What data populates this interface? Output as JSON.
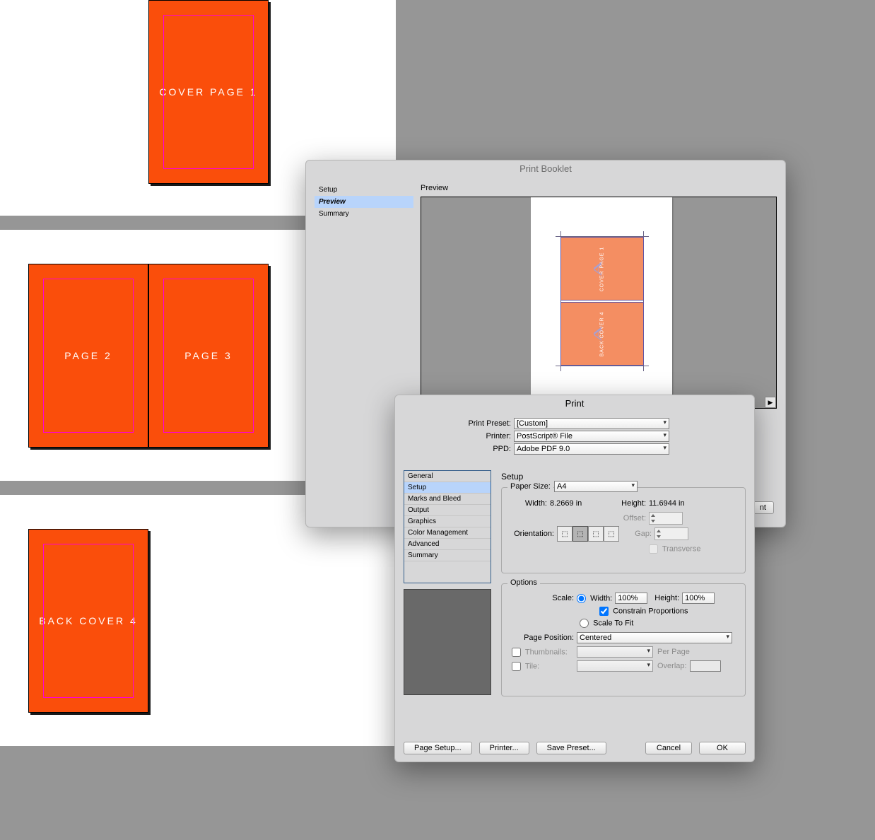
{
  "document": {
    "pages": [
      {
        "label": "COVER PAGE 1"
      },
      {
        "label": "PAGE 2"
      },
      {
        "label": "PAGE 3"
      },
      {
        "label": "BACK COVER 4"
      }
    ]
  },
  "booklet_dialog": {
    "title": "Print Booklet",
    "side_items": [
      "Setup",
      "Preview",
      "Summary"
    ],
    "selected_side": "Preview",
    "preview_label": "Preview",
    "preview_pages": [
      "COVER PAGE 1",
      "BACK COVER 4"
    ]
  },
  "print_dialog": {
    "title": "Print",
    "preset_label": "Print Preset:",
    "preset_value": "[Custom]",
    "printer_label": "Printer:",
    "printer_value": "PostScript® File",
    "ppd_label": "PPD:",
    "ppd_value": "Adobe PDF 9.0",
    "categories": [
      "General",
      "Setup",
      "Marks and Bleed",
      "Output",
      "Graphics",
      "Color Management",
      "Advanced",
      "Summary"
    ],
    "selected_category": "Setup",
    "setup": {
      "section_title": "Setup",
      "paper_size_label": "Paper Size:",
      "paper_size_value": "A4",
      "width_label": "Width:",
      "width_value": "8.2669 in",
      "height_label": "Height:",
      "height_value": "11.6944 in",
      "orientation_label": "Orientation:",
      "offset_label": "Offset:",
      "gap_label": "Gap:",
      "transverse_label": "Transverse"
    },
    "options": {
      "section_title": "Options",
      "scale_label": "Scale:",
      "width_label": "Width:",
      "width_value": "100%",
      "height_label": "Height:",
      "height_value": "100%",
      "constrain_label": "Constrain Proportions",
      "scale_fit_label": "Scale To Fit",
      "page_position_label": "Page Position:",
      "page_position_value": "Centered",
      "thumbnails_label": "Thumbnails:",
      "per_page_label": "Per Page",
      "tile_label": "Tile:",
      "overlap_label": "Overlap:"
    },
    "buttons": {
      "page_setup": "Page Setup...",
      "printer": "Printer...",
      "save_preset": "Save Preset...",
      "cancel": "Cancel",
      "ok": "OK"
    }
  }
}
